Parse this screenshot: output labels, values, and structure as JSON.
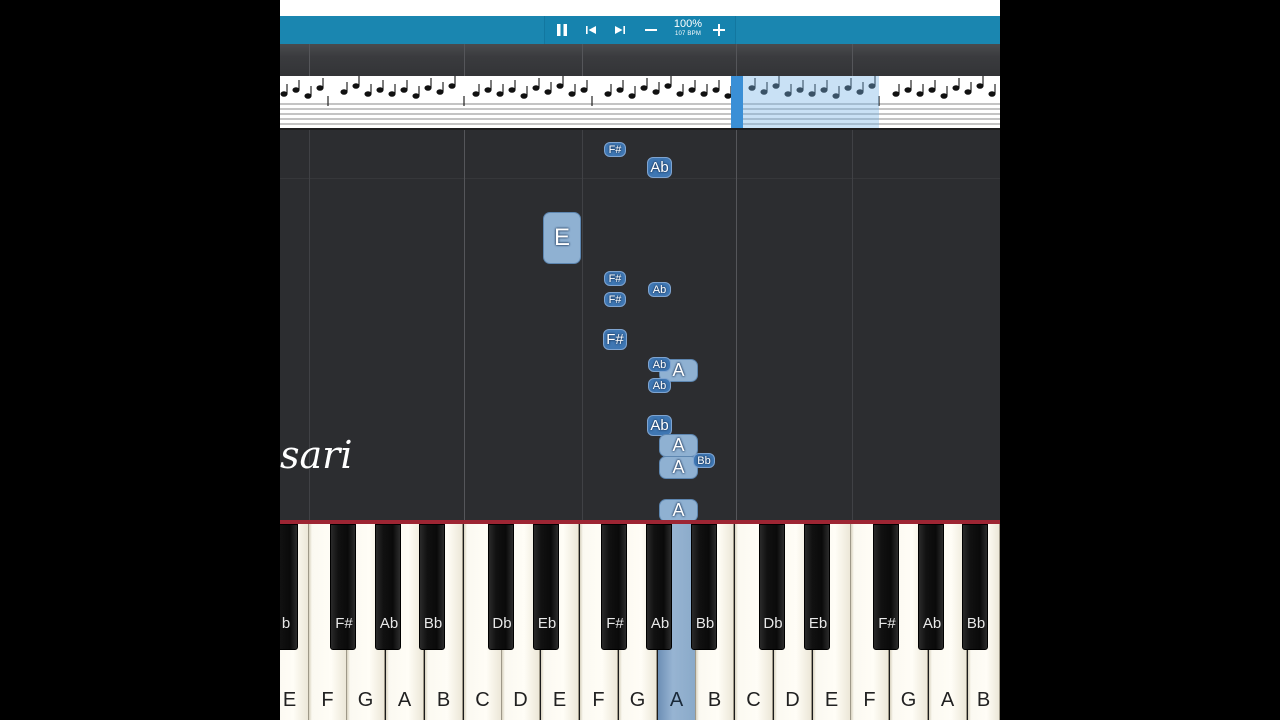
{
  "toolbar": {
    "zoom": "100%",
    "tempo": "107 BPM",
    "icons": [
      "pause-icon",
      "previous-icon",
      "next-icon",
      "zoom-out-icon",
      "zoom-in-icon"
    ]
  },
  "watermark": "sari",
  "notes": {
    "fs1": "F#",
    "ab1": "Ab",
    "e1": "E",
    "fs2": "F#",
    "ab2": "Ab",
    "fs3": "F#",
    "fs4": "F#",
    "ab3": "Ab",
    "a1": "A",
    "ab4": "Ab",
    "ab5": "Ab",
    "a2": "A",
    "a3": "A",
    "bb1": "Bb",
    "a4": "A"
  },
  "keyboard": {
    "white_keys": [
      "E",
      "F",
      "G",
      "A",
      "B",
      "C",
      "D",
      "E",
      "F",
      "G",
      "A",
      "B",
      "C",
      "D",
      "E",
      "F",
      "G",
      "A",
      "B"
    ],
    "black_keys": [
      "b",
      "F#",
      "Ab",
      "Bb",
      "Db",
      "Eb",
      "F#",
      "Ab",
      "Bb",
      "Db",
      "Eb",
      "F#",
      "Ab",
      "Bb"
    ],
    "active_key": "A"
  },
  "colors": {
    "toolbar": "#1a86b0",
    "note": "#3f77b3",
    "accent_line": "#9d2533",
    "active_key": "#8aaac9"
  }
}
